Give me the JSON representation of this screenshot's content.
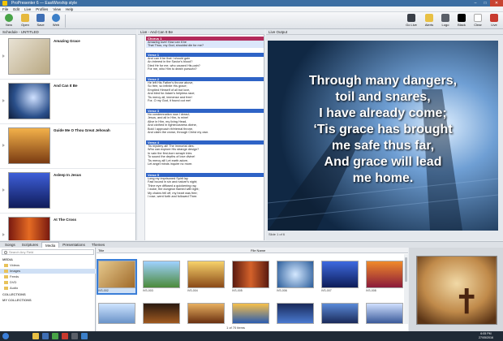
{
  "window": {
    "title": "ProPresenter 6 — EasiWorship style"
  },
  "menu": [
    "File",
    "Edit",
    "Live",
    "Profiles",
    "View",
    "Help"
  ],
  "toolbar": {
    "new": "New",
    "open": "Open",
    "save": "Save",
    "web": "Web",
    "golive": "Go Live",
    "alerts": "Alerts",
    "logo": "Logo",
    "black": "Black",
    "clear": "Clear",
    "live": "Live"
  },
  "schedule": {
    "header": "Schedule - UNTITLED",
    "items": [
      {
        "name": "Amazing Grace"
      },
      {
        "name": "And Can It Be"
      },
      {
        "name": "Guide Me O Thou Great Jehovah"
      },
      {
        "name": "Asleep In Jesus"
      },
      {
        "name": "At The Cross"
      }
    ]
  },
  "lyrics": {
    "header": "Live - And Can It Be",
    "verses": [
      {
        "title": "Chorus 1",
        "lines": [
          "Amazing love! How can it be",
          "That Thou, my God, shouldst die for me?"
        ]
      },
      {
        "title": "Verse 1",
        "lines": [
          "And can it be that I should gain",
          "An interest in the Savior's blood?",
          "Died He for me, who caused His pain?",
          "For me, who Him to death pursued?"
        ]
      },
      {
        "title": "Verse 2",
        "lines": [
          "He left His Father's throne above,",
          "So free, so infinite His grace;",
          "Emptied Himself of all but love,",
          "And bled for Adam's helpless race;",
          "Tis mercy all, immense and free!",
          "For, O my God, it found out me!"
        ]
      },
      {
        "title": "Verse 3",
        "lines": [
          "No condemnation now I dread;",
          "Jesus, and all in Him, is mine!",
          "Alive in Him, my living Head,",
          "And clothed in righteousness divine,",
          "Bold I approach th'eternal throne,",
          "And claim the crown, through Christ my own."
        ]
      },
      {
        "title": "Verse 4",
        "lines": [
          "Tis mystery all! The Immortal dies:",
          "Who can explore His strange design?",
          "In vain the first-born seraph tries",
          "To sound the depths of love divine!",
          "Tis mercy all! Let earth adore,",
          "Let angel minds inquire no more."
        ]
      },
      {
        "title": "Verse 5",
        "lines": [
          "Long my imprisoned Spirit lay",
          "Fast bound in sin and nature's night;",
          "Thine eye diffused a quickening ray,",
          "I woke, the dungeon flamed with light;",
          "My chains fell off, my heart was free;",
          "I rose, went forth and followed Thee."
        ]
      }
    ]
  },
  "output": {
    "header": "Live Output",
    "lines": [
      "Through many dangers,",
      "toil and snares,",
      "I have already come;",
      "‘Tis grace has brought",
      "me safe thus far,",
      "And grace will lead",
      "me home."
    ],
    "slide_info": "Slide 1 of 6"
  },
  "tabs": [
    "Songs",
    "Scriptures",
    "Media",
    "Presentations",
    "Themes"
  ],
  "media": {
    "search_placeholder": "Search Any Field",
    "tree": [
      {
        "label": "MEDIA",
        "group": true
      },
      {
        "label": "Videos"
      },
      {
        "label": "Images",
        "selected": true
      },
      {
        "label": "Feeds"
      },
      {
        "label": "DVD"
      },
      {
        "label": "Audio"
      },
      {
        "label": "COLLECTIONS",
        "group": true
      },
      {
        "label": "MY COLLECTIONS",
        "group": true
      }
    ],
    "columns": {
      "title": "Title",
      "file_name": "File Name"
    },
    "images": [
      "IVS-002",
      "IVS-003",
      "IVS-004",
      "IVS-005",
      "IVS-006",
      "IVS-007",
      "IVS-008"
    ],
    "pager": "1 of 70 items"
  },
  "taskbar": {
    "time": "6:05 PM",
    "date": "27/05/2016"
  }
}
